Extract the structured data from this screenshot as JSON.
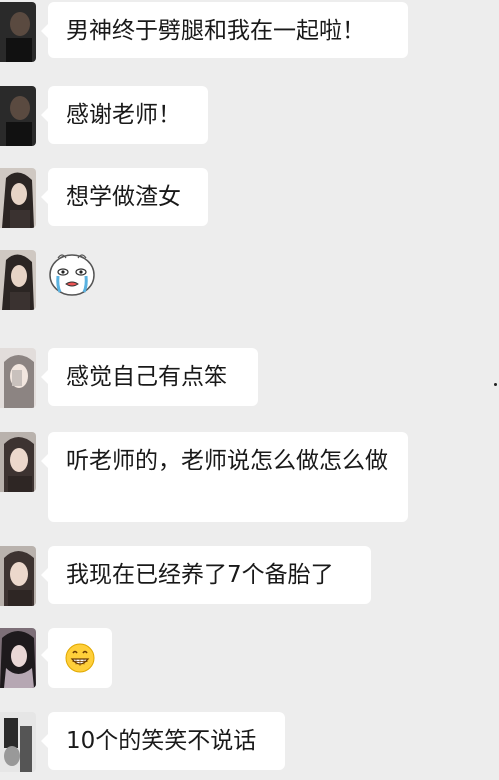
{
  "messages": [
    {
      "type": "text",
      "text": "男神终于劈腿和我在一起啦！"
    },
    {
      "type": "text",
      "text": "感谢老师！"
    },
    {
      "type": "text",
      "text": "想学做渣女"
    },
    {
      "type": "sticker",
      "icon": "crying-face-sticker-icon"
    },
    {
      "type": "text",
      "text": "感觉自己有点笨"
    },
    {
      "type": "text",
      "text": "听老师的，老师说怎么做怎么做"
    },
    {
      "type": "text",
      "text": "我现在已经养了7个备胎了"
    },
    {
      "type": "emoji",
      "text": "😁",
      "icon": "grinning-face-emoji-icon"
    },
    {
      "type": "text",
      "text": "10个的笑笑不说话"
    }
  ],
  "colors": {
    "background": "#ededed",
    "bubble": "#ffffff",
    "text": "#191919"
  }
}
